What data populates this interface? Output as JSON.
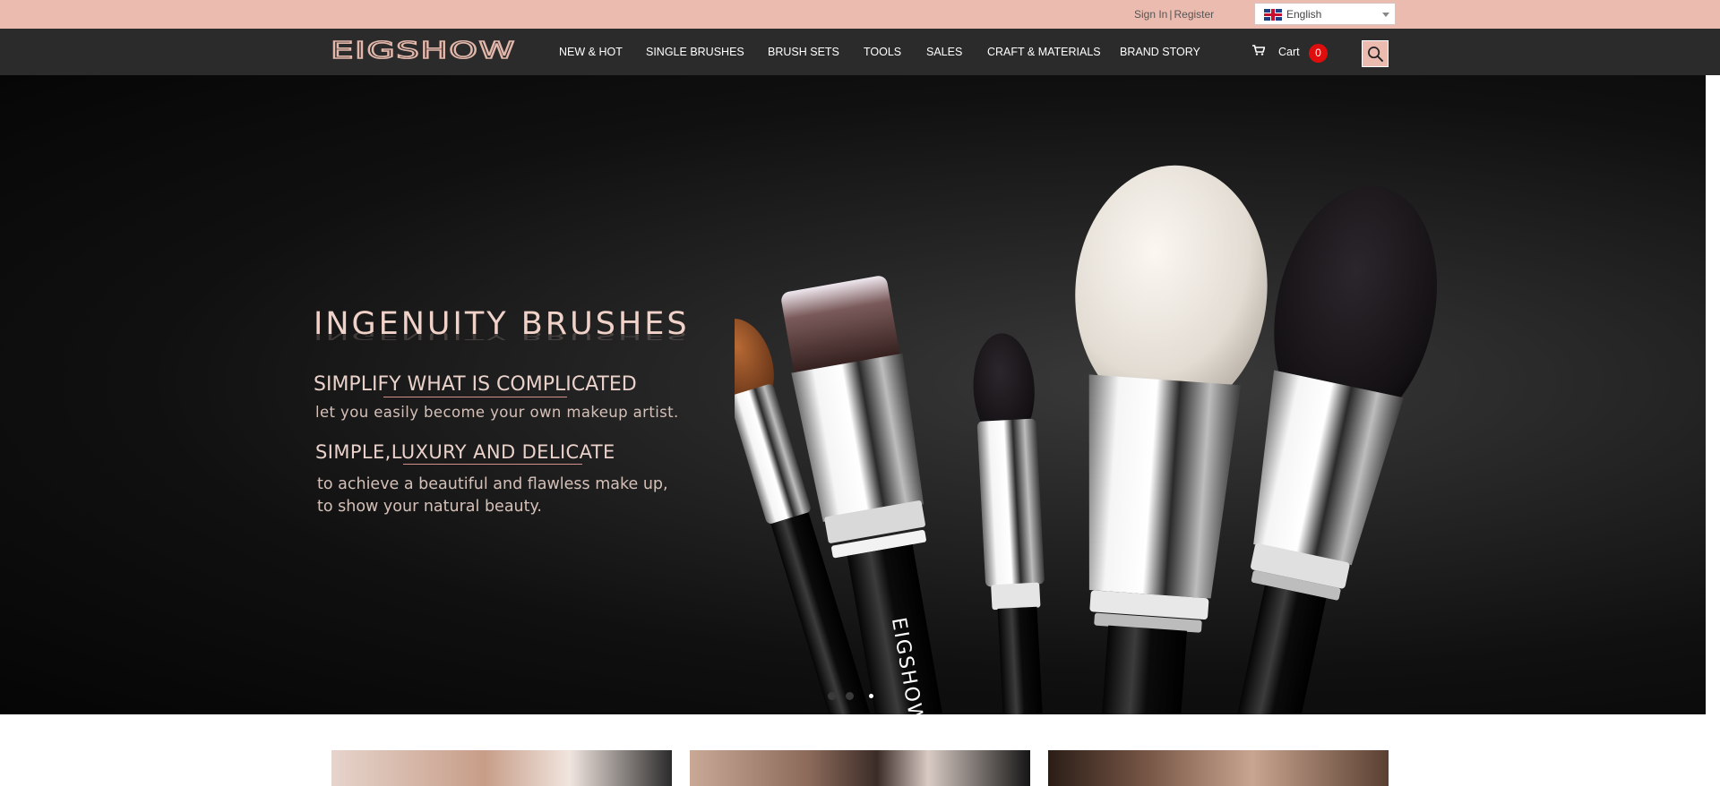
{
  "topbar": {
    "sign_in": "Sign In",
    "separator": "|",
    "register": "Register",
    "language": "English",
    "language_icon": "uk-flag-icon"
  },
  "nav": {
    "logo_text": "EIGSHOW",
    "items": [
      {
        "label": "NEW & HOT"
      },
      {
        "label": "SINGLE BRUSHES"
      },
      {
        "label": "BRUSH SETS"
      },
      {
        "label": "TOOLS"
      },
      {
        "label": "SALES"
      },
      {
        "label": "CRAFT & MATERIALS"
      },
      {
        "label": "BRAND STORY"
      }
    ],
    "cart_label": "Cart",
    "cart_count": "0",
    "search_icon": "search-icon"
  },
  "hero": {
    "headline": "INGENUITY BRUSHES",
    "line1": "SIMPLIFY WHAT IS COMPLICATED",
    "sub1": "let you easily become your own makeup artist.",
    "line2": "SIMPLE,LUXURY AND DELICATE",
    "sub2_a": "to achieve a beautiful and flawless make up,",
    "sub2_b": "to show your natural beauty.",
    "brand_on_handle": "EIGSHOW",
    "slides_total": 3,
    "active_slide": 3
  },
  "colors": {
    "topbar_bg": "#ecbbaf",
    "nav_bg": "#2b2b2b",
    "accent_pink": "#e3b7aa",
    "badge_red": "#e00d0d"
  }
}
